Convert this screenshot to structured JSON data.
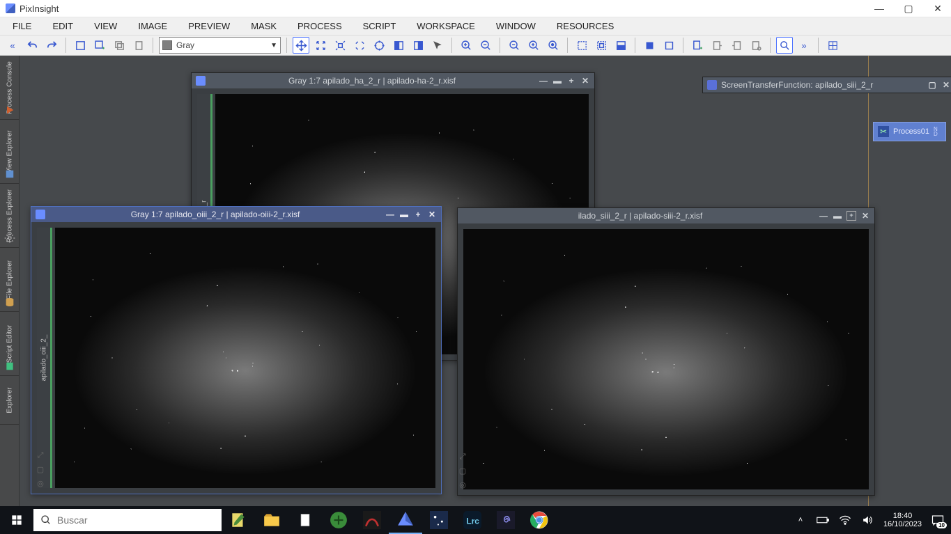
{
  "app": {
    "title": "PixInsight"
  },
  "win_controls": {
    "minimize": "—",
    "maximize": "▢",
    "close": "✕"
  },
  "menubar": [
    "FILE",
    "EDIT",
    "VIEW",
    "IMAGE",
    "PREVIEW",
    "MASK",
    "PROCESS",
    "SCRIPT",
    "WORKSPACE",
    "WINDOW",
    "RESOURCES"
  ],
  "toolbar": {
    "color_mode_label": "Gray"
  },
  "side_tabs": [
    {
      "label": "Process Console",
      "color": "#d06030"
    },
    {
      "label": "View Explorer",
      "color": "#6090d0"
    },
    {
      "label": "Process Explorer",
      "color": "#aaa"
    },
    {
      "label": "File Explorer",
      "color": "#d0a050"
    },
    {
      "label": "Script Editor",
      "color": "#40c080"
    },
    {
      "label": "Explorer",
      "color": "#888"
    }
  ],
  "windows": {
    "ha": {
      "title": "Gray 1:7 apilado_ha_2_r | apilado-ha-2_r.xisf",
      "tab": "apilado_ha_2_r"
    },
    "oiii": {
      "title": "Gray 1:7 apilado_oiii_2_r | apilado-oiii-2_r.xisf",
      "tab": "apilado_oiii_2_"
    },
    "siii": {
      "title": "ilado_siii_2_r | apilado-siii-2_r.xisf",
      "tab": ""
    }
  },
  "floater": {
    "title": "ScreenTransferFunction: apilado_siii_2_r"
  },
  "process_chip": {
    "label": "Process01"
  },
  "taskbar": {
    "search_placeholder": "Buscar",
    "clock_time": "18:40",
    "clock_date": "16/10/2023",
    "badge": "10"
  }
}
